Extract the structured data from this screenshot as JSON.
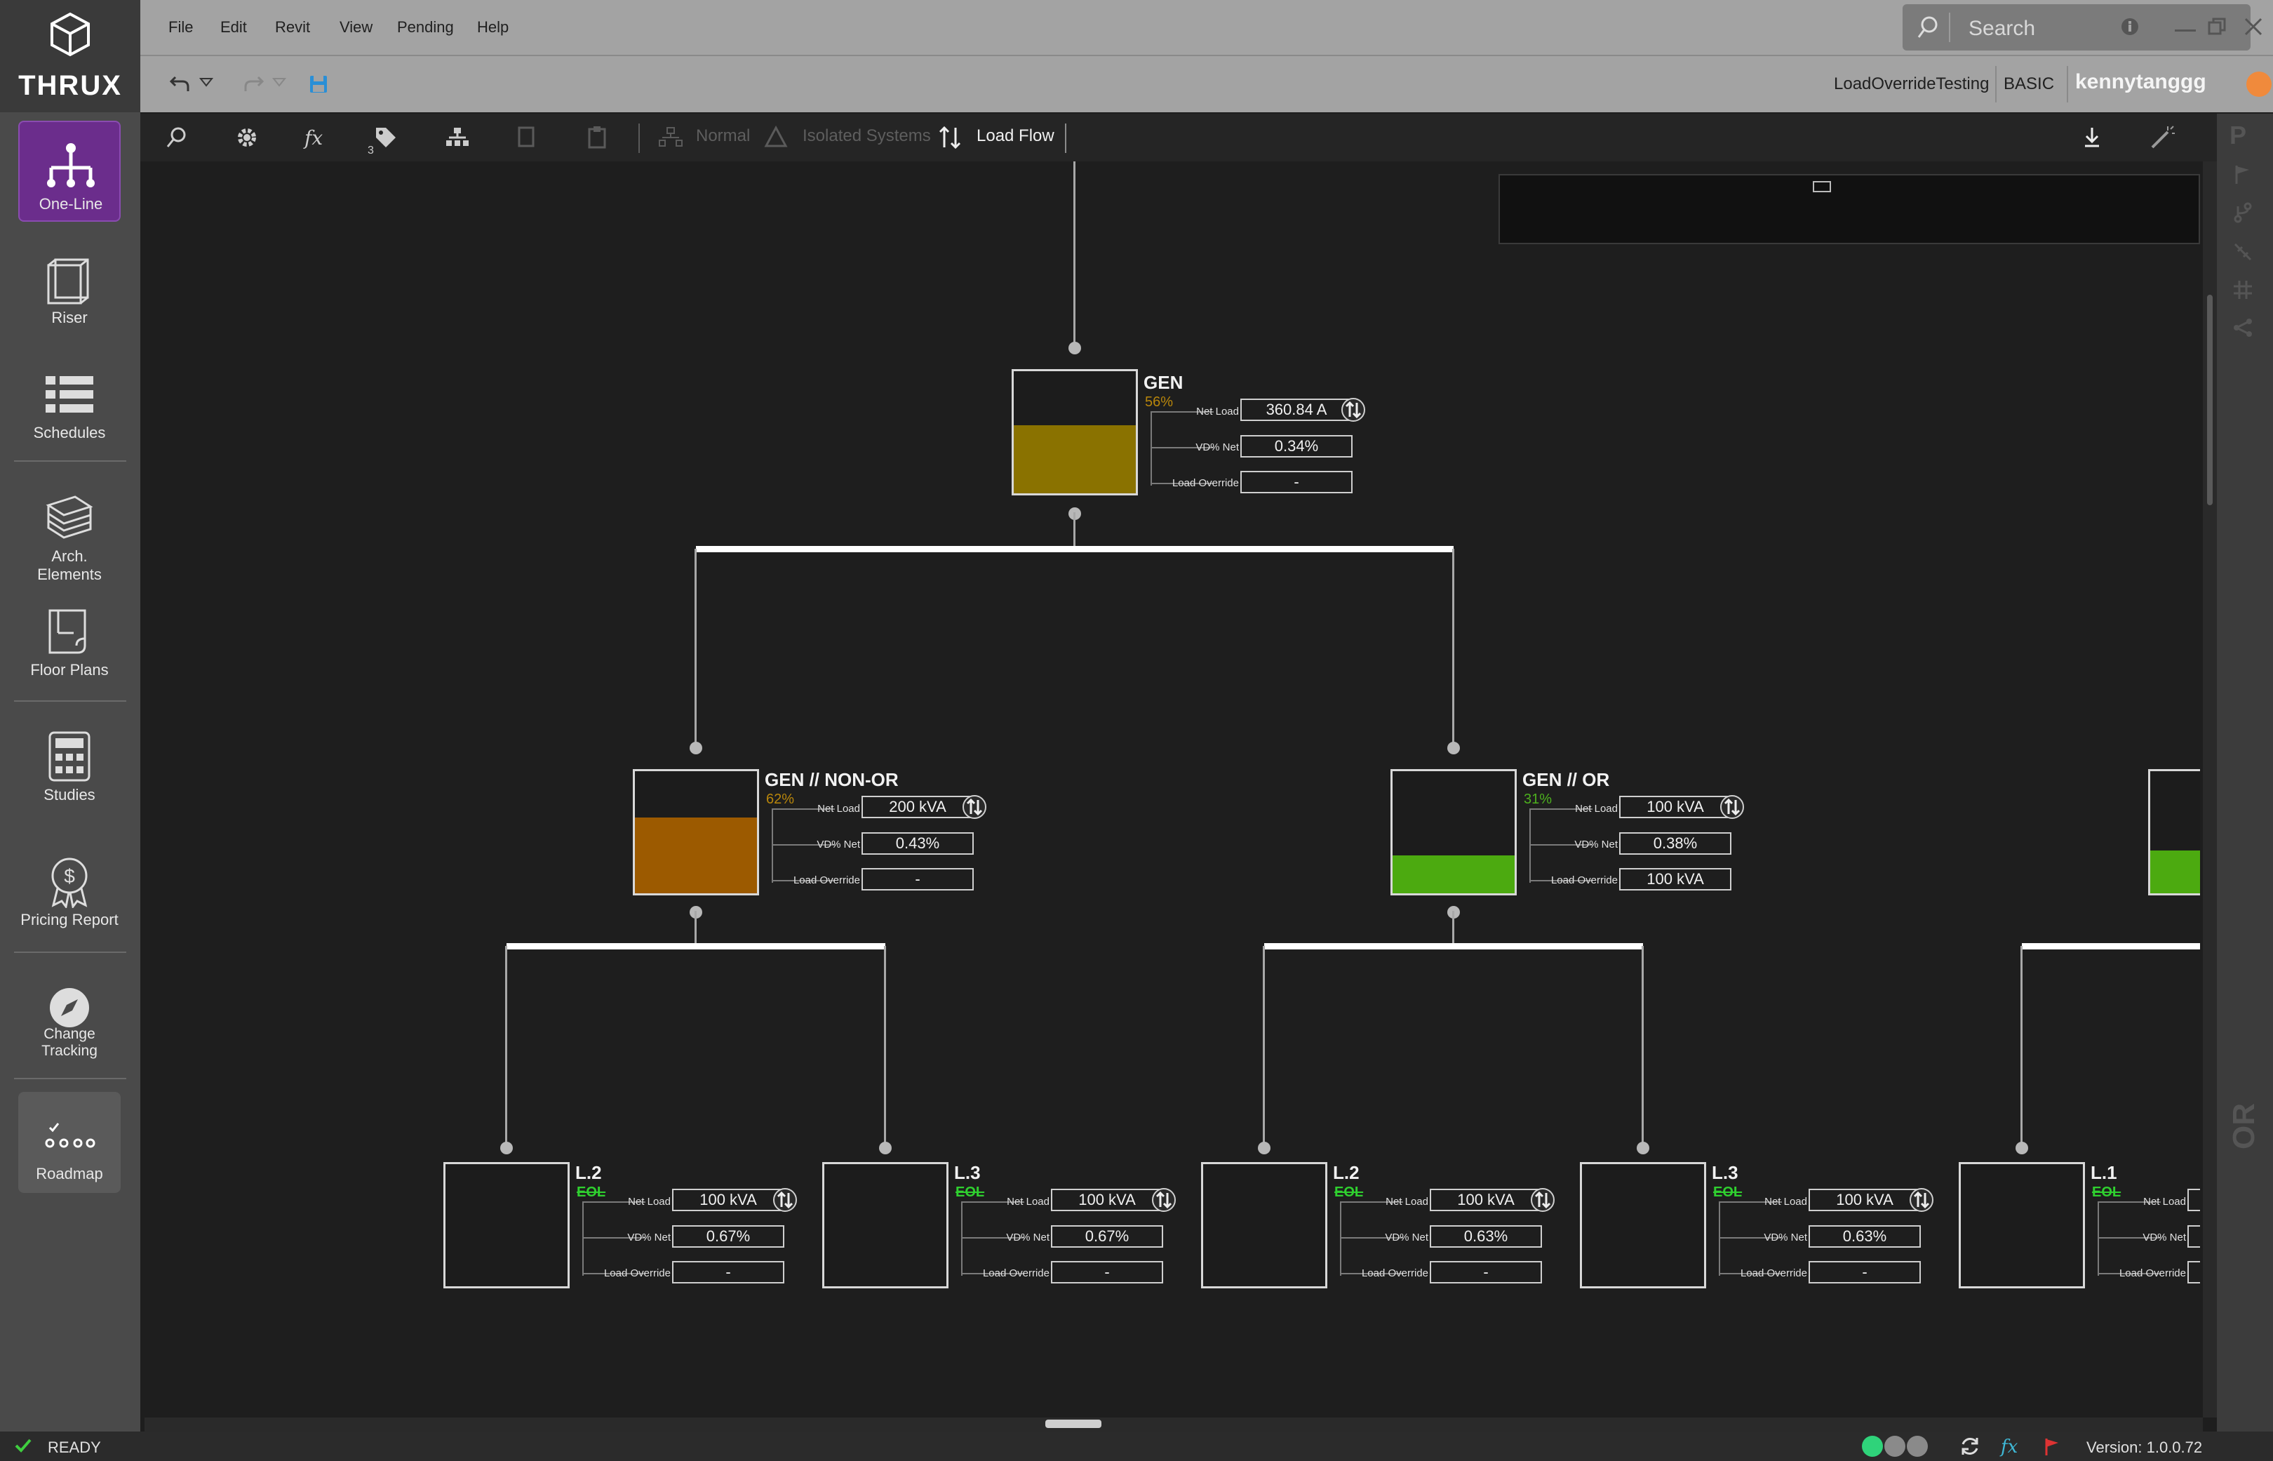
{
  "app": {
    "brand": "THRUX"
  },
  "menu": [
    "File",
    "Edit",
    "Revit",
    "View",
    "Pending",
    "Help"
  ],
  "search": {
    "placeholder": "Search"
  },
  "project": {
    "name": "LoadOverrideTesting",
    "tier": "BASIC",
    "user": "kennytanggg"
  },
  "toolbar": {
    "tag_count": "3",
    "normal_label": "Normal",
    "isolated_label": "Isolated Systems",
    "loadflow_label": "Load Flow"
  },
  "sidebar": [
    {
      "label": "One-Line",
      "icon": "one-line-icon"
    },
    {
      "label": "Riser",
      "icon": "riser-icon"
    },
    {
      "label": "Schedules",
      "icon": "schedules-icon"
    },
    {
      "label": "Arch. Elements",
      "icon": "arch-elements-icon"
    },
    {
      "label": "Floor Plans",
      "icon": "floor-plans-icon"
    },
    {
      "label": "Studies",
      "icon": "studies-icon"
    },
    {
      "label": "Pricing Report",
      "icon": "pricing-report-icon"
    },
    {
      "label": "Change Tracking",
      "icon": "change-tracking-icon"
    },
    {
      "label": "Roadmap",
      "icon": "roadmap-icon"
    }
  ],
  "rail": {
    "top_letter": "P",
    "bottom_letters": "OR"
  },
  "field_labels": {
    "net_load": "Net Load",
    "vd_net": "VD% Net",
    "override": "Load Override"
  },
  "nodes": [
    {
      "title": "GEN",
      "pct": "56%",
      "pct_color": "#b8860b",
      "fill_color": "#8a7200",
      "fill": 0.56,
      "net_load": "360.84 A",
      "vd_net": "0.34%",
      "override": "-"
    },
    {
      "title": "GEN // NON-OR",
      "pct": "62%",
      "pct_color": "#b8860b",
      "fill_color": "#9c5a00",
      "fill": 0.62,
      "net_load": "200 kVA",
      "vd_net": "0.43%",
      "override": "-"
    },
    {
      "title": "GEN // OR",
      "pct": "31%",
      "pct_color": "#4db01e",
      "fill_color": "#4caa10",
      "fill": 0.31,
      "net_load": "100 kVA",
      "vd_net": "0.38%",
      "override": "100 kVA"
    },
    {
      "title": "L.2",
      "pct": "EOL",
      "pct_color": "#2fd02f",
      "net_load": "100 kVA",
      "vd_net": "0.67%",
      "override": "-"
    },
    {
      "title": "L.3",
      "pct": "EOL",
      "pct_color": "#2fd02f",
      "net_load": "100 kVA",
      "vd_net": "0.67%",
      "override": "-"
    },
    {
      "title": "L.2",
      "pct": "EOL",
      "pct_color": "#2fd02f",
      "net_load": "100 kVA",
      "vd_net": "0.63%",
      "override": "-"
    },
    {
      "title": "L.3",
      "pct": "EOL",
      "pct_color": "#2fd02f",
      "net_load": "100 kVA",
      "vd_net": "0.63%",
      "override": "-"
    },
    {
      "title": "L.1",
      "pct": "EOL",
      "pct_color": "#2fd02f"
    }
  ],
  "status": {
    "text": "READY",
    "version": "Version: 1.0.0.72"
  }
}
